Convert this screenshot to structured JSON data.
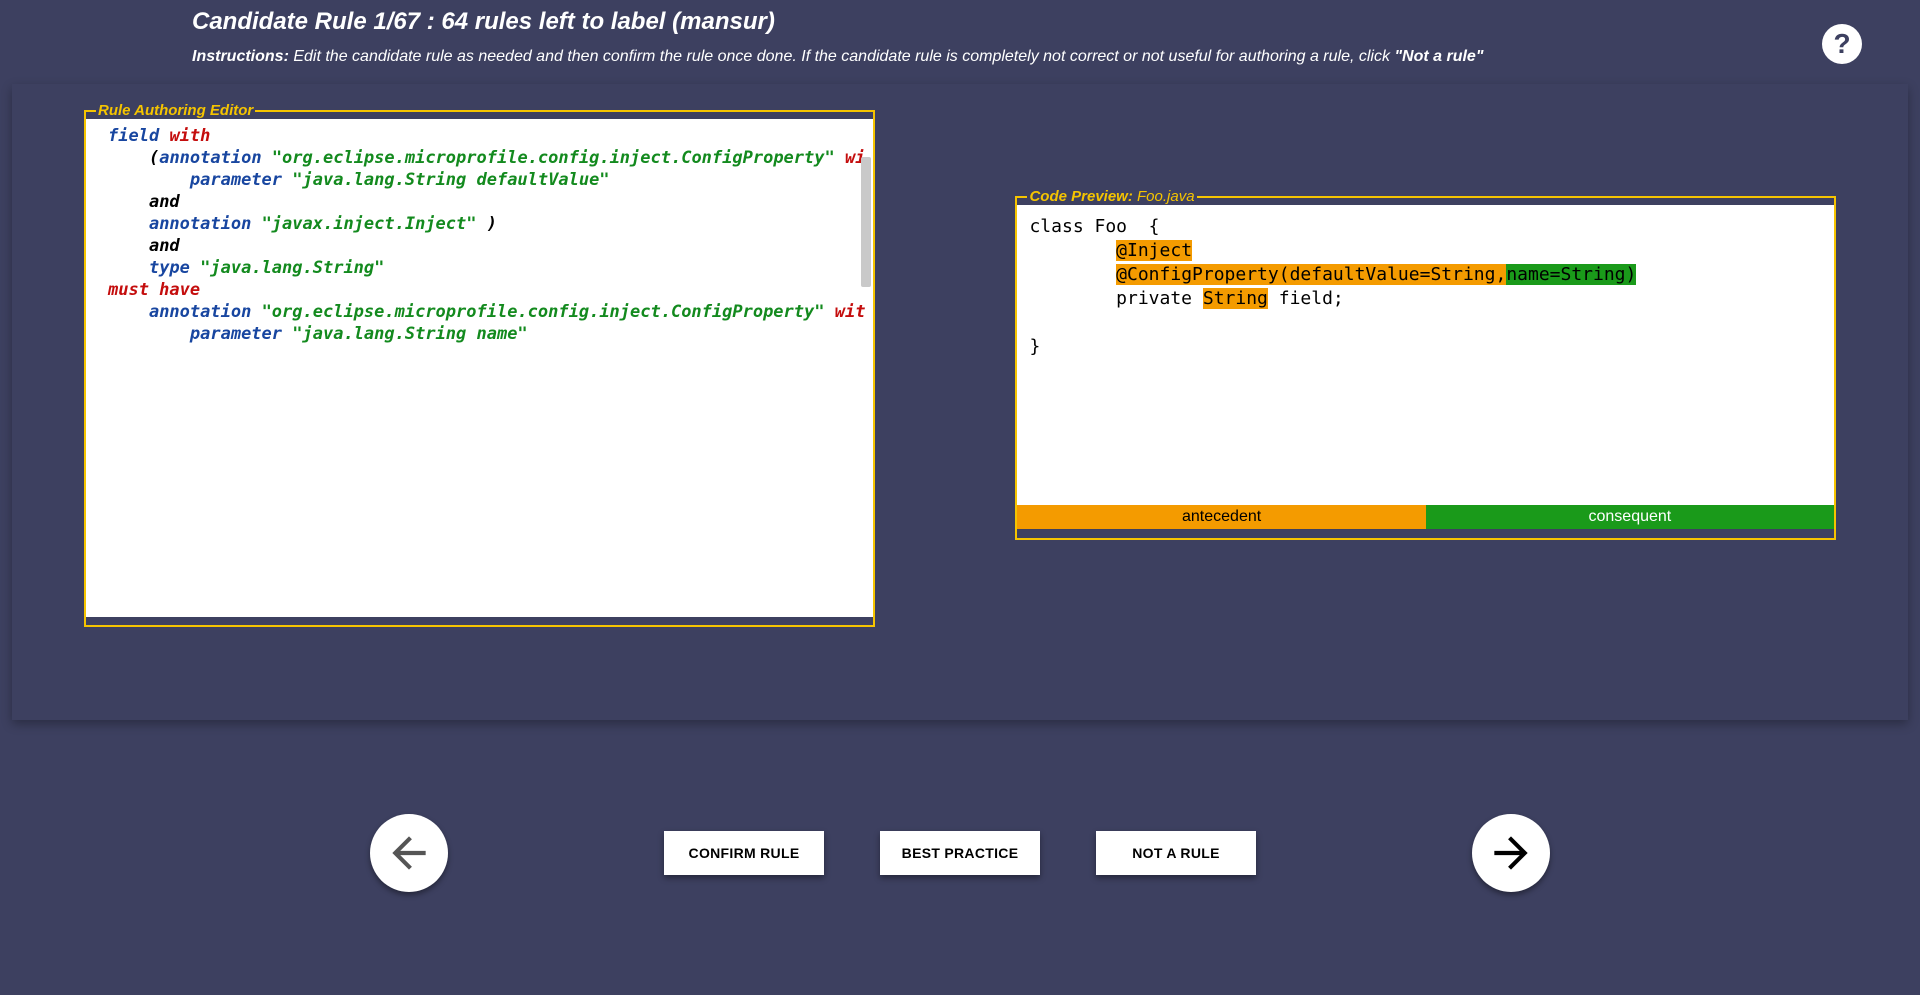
{
  "header": {
    "title": "Candidate Rule 1/67 : 64 rules left to label (mansur)",
    "instructions_label": "Instructions:",
    "instructions_text": " Edit the candidate rule as needed and then confirm the rule once done. If the candidate rule is completely not correct or not useful for authoring a rule, click ",
    "not_a_rule_emph": "\"Not a rule\""
  },
  "help": {
    "glyph": "?"
  },
  "editor": {
    "legend": "Rule Authoring Editor",
    "tokens": {
      "l1_field": "field",
      "l1_with": "with",
      "l2_paren": "(",
      "l2_annotation": "annotation",
      "l2_str": "\"org.eclipse.microprofile.config.inject.ConfigProperty\"",
      "l2_wi": "wi",
      "l3_parameter": "parameter",
      "l3_str": "\"java.lang.String defaultValue\"",
      "l4_and": "and",
      "l5_annotation": "annotation",
      "l5_str": "\"javax.inject.Inject\"",
      "l5_paren": ")",
      "l6_and": "and",
      "l7_type": "type",
      "l7_str": "\"java.lang.String\"",
      "l8_must_have": "must have",
      "l9_annotation": "annotation",
      "l9_str": "\"org.eclipse.microprofile.config.inject.ConfigProperty\"",
      "l9_wit": "wit",
      "l10_parameter": "parameter",
      "l10_str": "\"java.lang.String name\""
    }
  },
  "preview": {
    "legend_label": "Code Preview",
    "legend_file": "Foo.java",
    "code": {
      "l1": "class Foo  {",
      "l2_indent": "        ",
      "l2_inject": "@Inject",
      "l3_indent": "        ",
      "l3_cp": "@ConfigProperty(defaultValue=String",
      "l3_comma": ",",
      "l3_name": "name=String)",
      "l4_a": "        private ",
      "l4_string": "String",
      "l4_b": " field;",
      "l6": "}"
    },
    "legend_bar": {
      "antecedent": "antecedent",
      "consequent": "consequent"
    }
  },
  "footer": {
    "confirm": "CONFIRM RULE",
    "best_practice": "BEST PRACTICE",
    "not_a_rule": "NOT A RULE"
  }
}
